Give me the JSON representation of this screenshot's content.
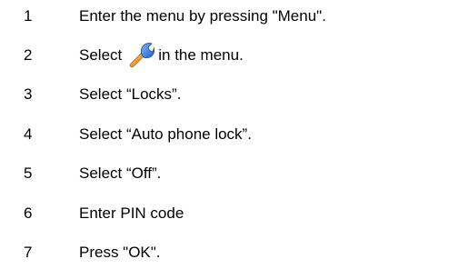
{
  "steps": [
    {
      "number": "1",
      "text": "Enter the menu by pressing \"Menu\"."
    },
    {
      "number": "2",
      "text_before": "Select",
      "icon": "wrench-icon",
      "text_after": "in the menu."
    },
    {
      "number": "3",
      "text": "Select “Locks”."
    },
    {
      "number": "4",
      "text": "Select “Auto phone lock”."
    },
    {
      "number": "5",
      "text": "Select “Off”."
    },
    {
      "number": "6",
      "text": "Enter PIN code"
    },
    {
      "number": "7",
      "text": "Press \"OK\"."
    }
  ],
  "colors": {
    "text": "#000000",
    "icon_orange": "#f39a1e",
    "icon_blue": "#2a6fd6"
  }
}
